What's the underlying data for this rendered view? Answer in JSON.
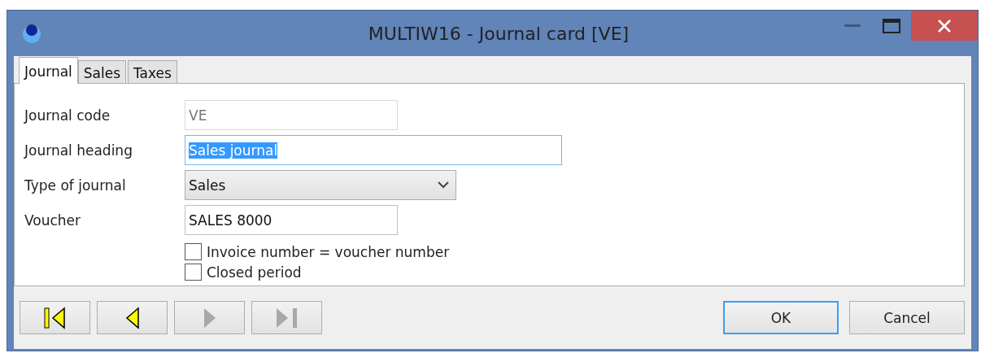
{
  "window": {
    "title": "MULTIW16 - Journal card [VE]"
  },
  "tabs": [
    {
      "label": "Journal",
      "selected": true
    },
    {
      "label": "Sales",
      "selected": false
    },
    {
      "label": "Taxes",
      "selected": false
    }
  ],
  "fields": [
    {
      "label": "Journal code",
      "kind": "text",
      "value": "VE",
      "disabled": true,
      "focused": false
    },
    {
      "label": "Journal heading",
      "kind": "text",
      "value": "Sales journal",
      "disabled": false,
      "focused": true
    },
    {
      "label": "Type of journal",
      "kind": "select",
      "value": "Sales",
      "disabled": false,
      "focused": false
    },
    {
      "label": "Voucher",
      "kind": "text",
      "value": "SALES 8000",
      "disabled": false,
      "focused": false
    }
  ],
  "checkboxes": [
    {
      "label": "Invoice number = voucher number",
      "checked": false
    },
    {
      "label": "Closed period",
      "checked": false
    }
  ],
  "navigation": [
    {
      "kind": "first",
      "disabled": false
    },
    {
      "kind": "previous",
      "disabled": false
    },
    {
      "kind": "next",
      "disabled": true
    },
    {
      "kind": "last",
      "disabled": true
    }
  ],
  "buttons": [
    {
      "label": "OK",
      "focused": true
    },
    {
      "label": "Cancel",
      "focused": false
    }
  ]
}
